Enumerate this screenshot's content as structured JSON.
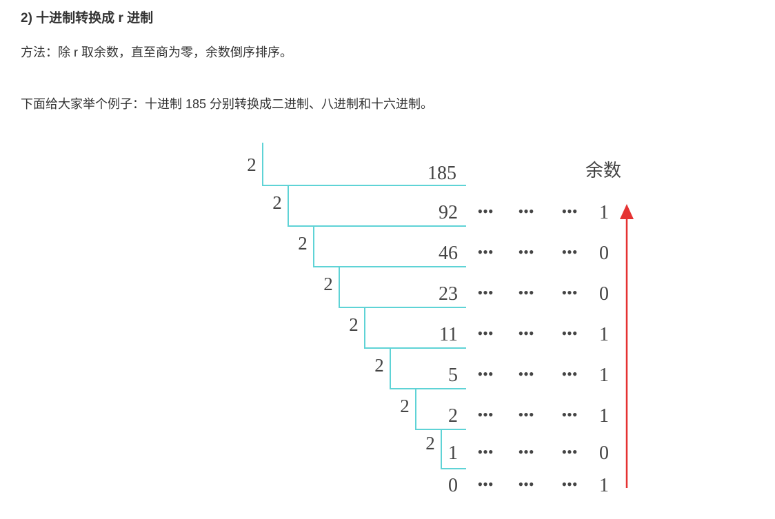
{
  "heading": "2) 十进制转换成 r 进制",
  "method_text": "方法：除 r 取余数，直至商为零，余数倒序排序。",
  "example_text": "下面给大家举个例子：十进制 185 分别转换成二进制、八进制和十六进制。",
  "diagram": {
    "divisor": "2",
    "dividend": "185",
    "remainder_header": "余数",
    "dots": "•••",
    "steps": [
      {
        "quotient": "92",
        "remainder": "1"
      },
      {
        "quotient": "46",
        "remainder": "0"
      },
      {
        "quotient": "23",
        "remainder": "0"
      },
      {
        "quotient": "11",
        "remainder": "1"
      },
      {
        "quotient": "5",
        "remainder": "1"
      },
      {
        "quotient": "2",
        "remainder": "1"
      },
      {
        "quotient": "1",
        "remainder": "0"
      },
      {
        "quotient": "0",
        "remainder": "1"
      }
    ],
    "colors": {
      "bracket": "#5fd3d6",
      "arrow": "#e53333",
      "text": "#444444"
    }
  }
}
